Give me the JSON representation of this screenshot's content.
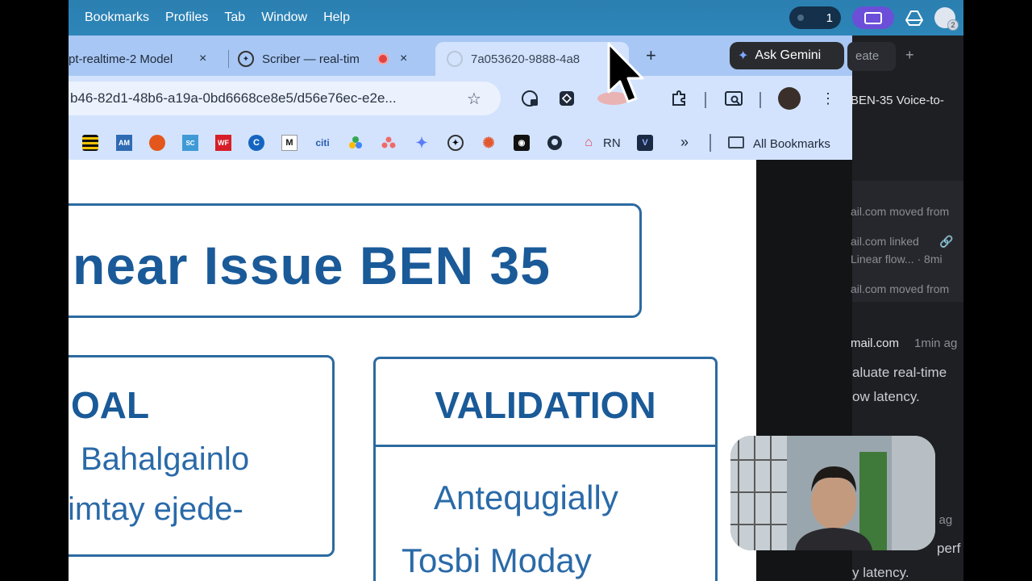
{
  "menubar": {
    "items": [
      "Bookmarks",
      "Profiles",
      "Tab",
      "Window",
      "Help"
    ],
    "notification_count": "1",
    "avatar_badge": "2"
  },
  "tabs": [
    {
      "title": "pt-realtime-2 Model",
      "close": "×"
    },
    {
      "title": "Scriber — real-tim",
      "close": "×"
    },
    {
      "title": "7a053620-9888-4a8",
      "close": "×"
    }
  ],
  "new_tab": "+",
  "gemini": {
    "label": "Ask Gemini"
  },
  "address_bar": {
    "url": "b46-82d1-48b6-a19a-0bd6668ce8e5/d56e76ec-e2e..."
  },
  "bookmarks": {
    "labels": {
      "rn": "RN",
      "overflow": "»",
      "all": "All Bookmarks"
    }
  },
  "page": {
    "title": "near Issue BEN 35",
    "goal": {
      "heading": "OAL",
      "line1": "Bahalgainlo",
      "line2": "imtay ejede-"
    },
    "validation": {
      "heading": "VALIDATION",
      "line1": "Antequgially",
      "line2": "Tosbi Moday"
    }
  },
  "linear": {
    "tab_label": "eate",
    "tab_plus": "+",
    "issue_title": "BEN-35 Voice-to-",
    "activity": [
      "ail.com moved from",
      "ail.com linked",
      "Linear flow... · 8mi",
      "ail.com moved from"
    ],
    "comment": {
      "author": "mail.com",
      "time": "1min ag",
      "line1": "aluate real-time",
      "line2": "ow latency."
    },
    "bottom": {
      "time": "n ag",
      "line1": "perf",
      "line2": "y latency."
    }
  }
}
